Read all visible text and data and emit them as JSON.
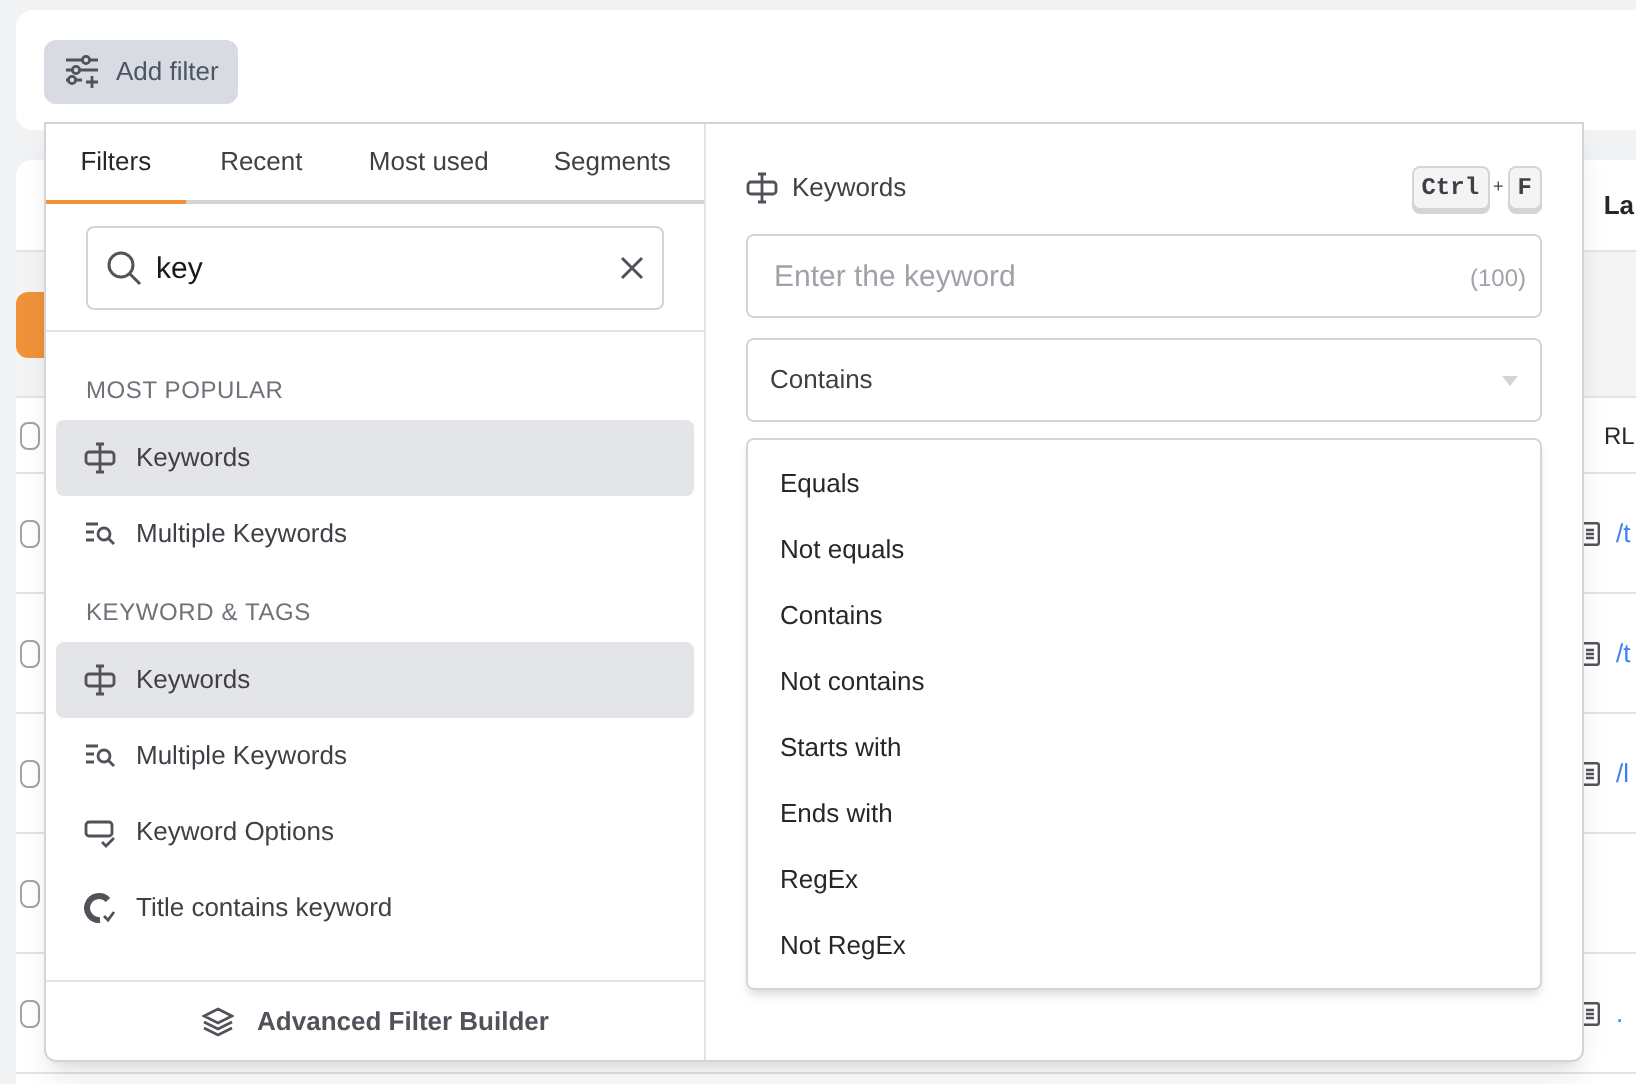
{
  "add_filter_button": {
    "label": "Add filter"
  },
  "filter_panel": {
    "tabs": [
      {
        "label": "Filters",
        "selected": true
      },
      {
        "label": "Recent",
        "selected": false
      },
      {
        "label": "Most used",
        "selected": false
      },
      {
        "label": "Segments",
        "selected": false
      }
    ],
    "search": {
      "value": "key"
    },
    "sections": [
      {
        "heading": "MOST POPULAR",
        "items": [
          {
            "label": "Keywords",
            "kind": "keyword",
            "selected": true
          },
          {
            "label": "Multiple Keywords",
            "kind": "multiple",
            "selected": false
          }
        ]
      },
      {
        "heading": "KEYWORD & TAGS",
        "items": [
          {
            "label": "Keywords",
            "kind": "keyword",
            "selected": true
          },
          {
            "label": "Multiple Keywords",
            "kind": "multiple",
            "selected": false
          },
          {
            "label": "Keyword Options",
            "kind": "options",
            "selected": false
          },
          {
            "label": "Title contains keyword",
            "kind": "title",
            "selected": false
          }
        ]
      }
    ],
    "footer": {
      "label": "Advanced Filter Builder"
    }
  },
  "detail": {
    "title": "Keywords",
    "shortcut": [
      "Ctrl",
      "F"
    ],
    "shortcut_joiner": "+",
    "input": {
      "placeholder": "Enter the keyword",
      "counter": "(100)"
    },
    "operator": {
      "value": "Contains",
      "expanded": true
    },
    "options": [
      "Equals",
      "Not equals",
      "Contains",
      "Not contains",
      "Starts with",
      "Ends with",
      "RegEx",
      "Not RegEx"
    ]
  },
  "background_table": {
    "column_header": "La",
    "header_cell": "RL",
    "header_checked": false,
    "rows": [
      {
        "link": "/t",
        "checked": false
      },
      {
        "link": "/t",
        "checked": false
      },
      {
        "link": "/l",
        "checked": false
      },
      {
        "checked": false
      },
      {
        "link": ".",
        "checked": false
      }
    ]
  }
}
